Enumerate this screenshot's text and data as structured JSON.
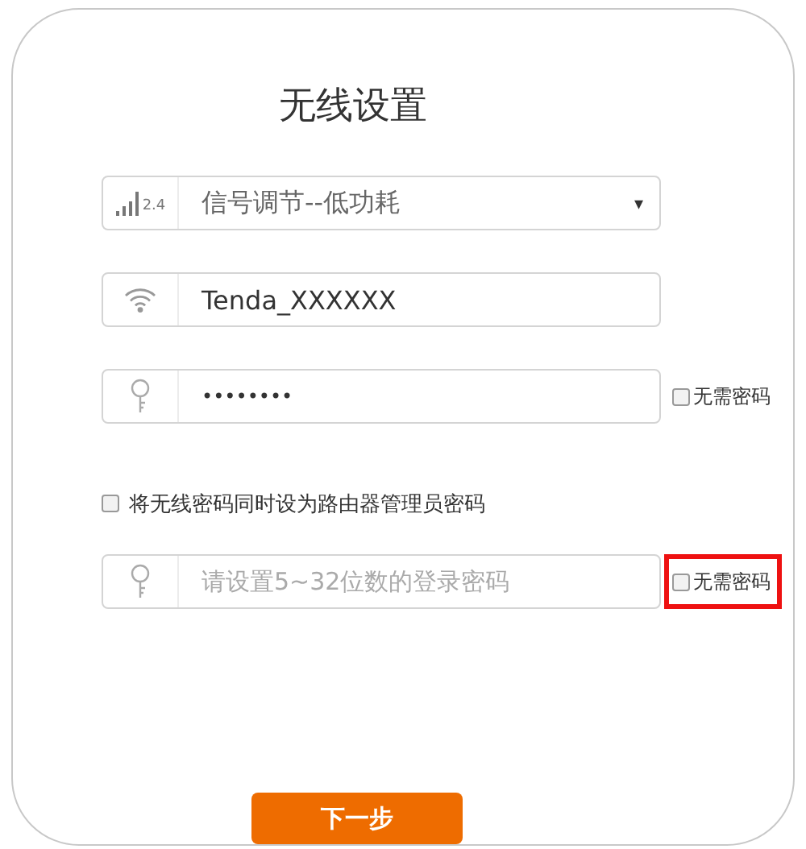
{
  "title": "无线设置",
  "fields": [
    {
      "kind": "select",
      "band": "2.4",
      "value": "信号调节--低功耗",
      "arrow": "▾"
    },
    {
      "kind": "text",
      "value": "Tenda_XXXXXX"
    },
    {
      "kind": "password",
      "value": "••••••••",
      "no_password": {
        "label": "无需密码",
        "checked": false,
        "highlighted": false
      }
    },
    {
      "kind": "checkbox",
      "label": "将无线密码同时设为路由器管理员密码",
      "checked": false
    },
    {
      "kind": "password",
      "placeholder": "请设置5~32位数的登录密码",
      "no_password": {
        "label": "无需密码",
        "checked": false,
        "highlighted": true
      }
    }
  ],
  "next_button": "下一步"
}
